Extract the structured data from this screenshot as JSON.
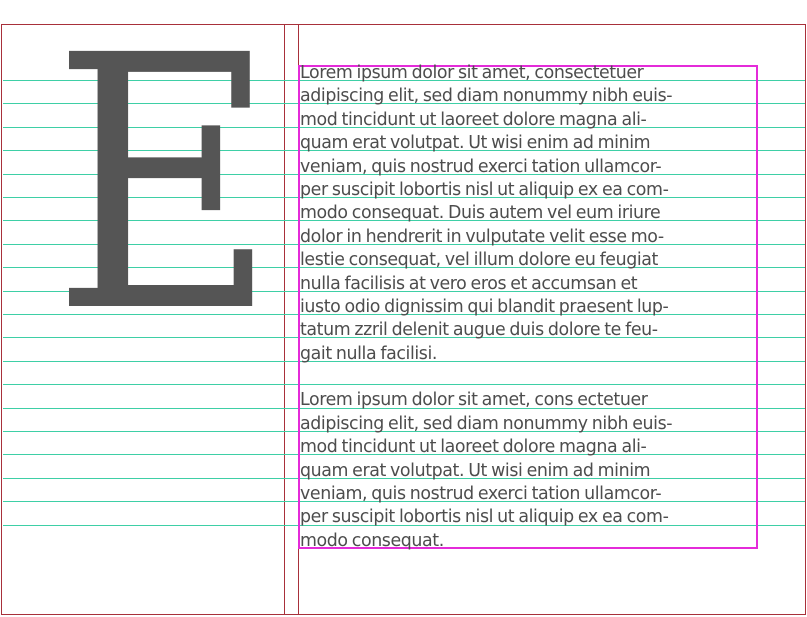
{
  "drop_cap": "E",
  "paragraphs": [
    {
      "lines": [
        "Lorem ipsum dolor sit amet, consectetuer",
        "adipiscing elit, sed diam nonummy nibh euis-",
        "mod tincidunt ut laoreet dolore magna ali-",
        "quam erat volutpat. Ut wisi enim ad minim",
        "veniam, quis nostrud exerci tation ullamcor-",
        "per suscipit lobortis nisl ut aliquip ex ea com-",
        "modo consequat. Duis autem vel eum iriure",
        "dolor in hendrerit in vulputate velit esse mo-",
        "lestie consequat, vel illum dolore eu feugiat",
        "nulla facilisis at vero eros et accumsan et",
        "iusto odio dignissim qui blandit praesent lup-",
        "tatum zzril delenit augue duis dolore te feu-",
        "gait nulla facilisi."
      ]
    },
    {
      "lines": [
        "Lorem ipsum dolor sit amet, cons ectetuer",
        "adipiscing elit, sed diam nonummy nibh euis-",
        "mod tincidunt ut laoreet dolore magna ali-",
        "quam erat volutpat. Ut wisi enim ad minim",
        "veniam, quis nostrud exerci tation ullamcor-",
        "per suscipit lobortis nisl ut aliquip ex ea com-",
        "modo consequat."
      ]
    }
  ],
  "colors": {
    "text": "#4d4d4d",
    "drop_cap": "#555555",
    "baseline_grid": "#3ecfa6",
    "frame_selection": "#e42bd9",
    "margin_guides": "#a8303a"
  }
}
